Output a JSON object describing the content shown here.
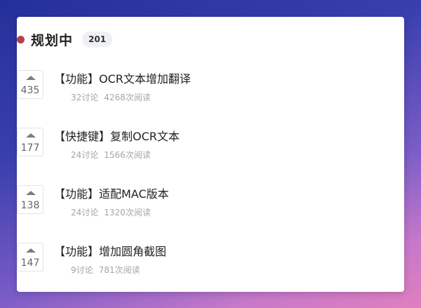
{
  "header": {
    "title": "规划中",
    "count": "201",
    "status_color": "#b0444a"
  },
  "items": [
    {
      "votes": "435",
      "title": "【功能】OCR文本增加翻译",
      "discussions": "32讨论",
      "reads": "4268次阅读"
    },
    {
      "votes": "177",
      "title": "【快捷键】复制OCR文本",
      "discussions": "24讨论",
      "reads": "1566次阅读"
    },
    {
      "votes": "138",
      "title": "【功能】适配MAC版本",
      "discussions": "24讨论",
      "reads": "1320次阅读"
    },
    {
      "votes": "147",
      "title": "【功能】增加圆角截图",
      "discussions": "9讨论",
      "reads": "781次阅读"
    }
  ]
}
